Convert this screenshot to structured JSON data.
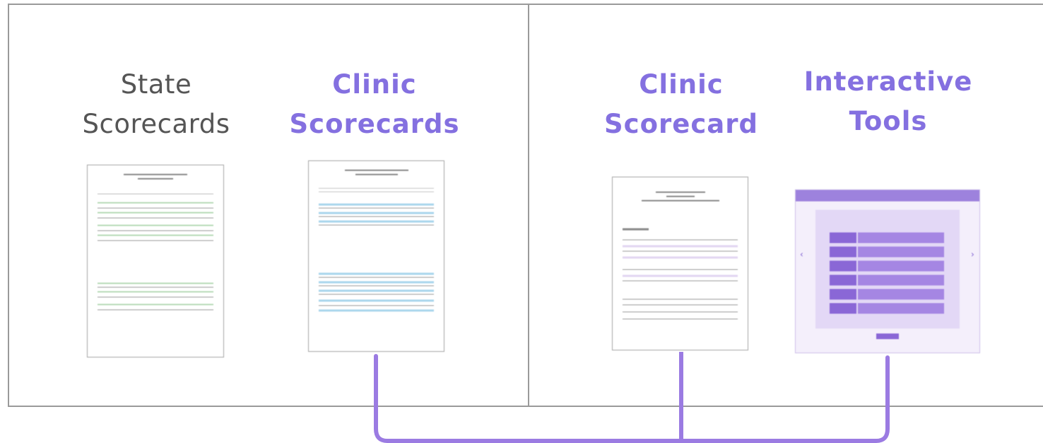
{
  "panels": {
    "left": {
      "items": [
        {
          "label": "State\nScorecards"
        },
        {
          "label": "Clinic\nScorecards"
        }
      ]
    },
    "right": {
      "items": [
        {
          "label": "Clinic\nScorecard"
        },
        {
          "label": "Interactive\nTools"
        }
      ]
    }
  },
  "colors": {
    "accent": "#8470e0",
    "plain_label": "#555555",
    "panel_border": "#9a9a9a",
    "connector": "#9b7be2"
  }
}
